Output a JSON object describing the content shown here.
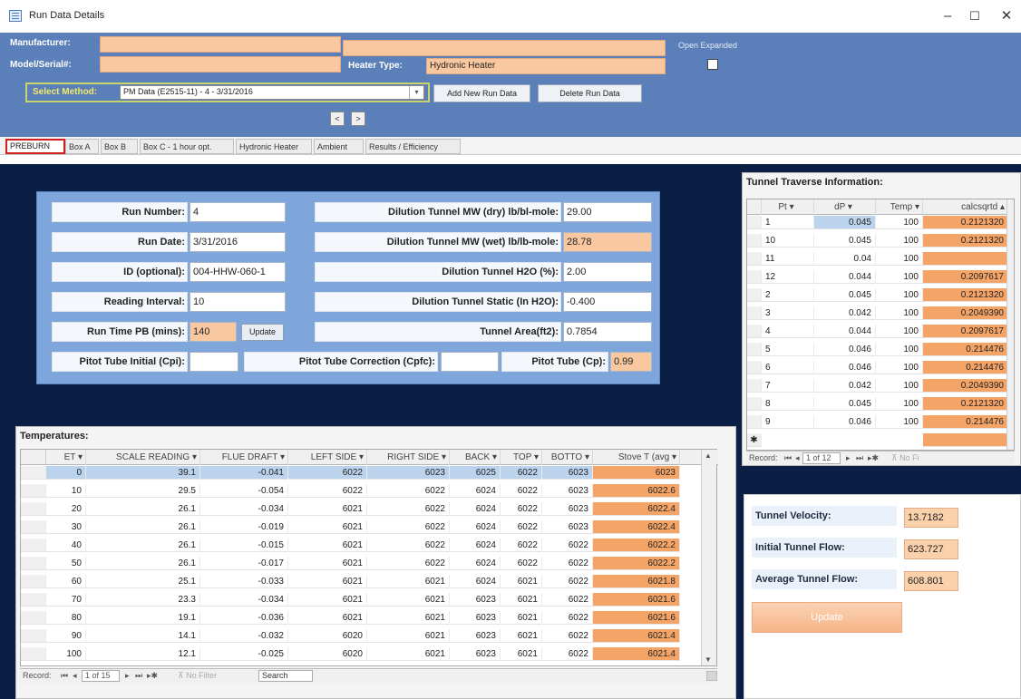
{
  "window": {
    "title": "Run Data Details",
    "minimize": "–",
    "maximize": "☐",
    "close": "✕"
  },
  "header": {
    "manufacturer_label": "Manufacturer:",
    "manufacturer_value": "",
    "manufacturer_value2": "",
    "model_label": "Model/Serial#:",
    "model_value": "",
    "heater_type_label": "Heater Type:",
    "heater_type_value": "Hydronic Heater",
    "open_expanded_label": "Open Expanded",
    "open_expanded_checked": false,
    "select_method_label": "Select Method:",
    "select_method_value": "PM Data (E2515-11) - 4 - 3/31/2016",
    "add_button": "Add New Run Data",
    "delete_button": "Delete Run Data",
    "prev": "<",
    "next": ">"
  },
  "tabs": [
    {
      "label": "PREBURN"
    },
    {
      "label": "Box A"
    },
    {
      "label": "Box B"
    },
    {
      "label": "Box C - 1 hour opt."
    },
    {
      "label": "Hydronic Heater"
    },
    {
      "label": "Ambient"
    },
    {
      "label": "Results / Efficiency"
    }
  ],
  "run": {
    "run_number_label": "Run Number:",
    "run_number": "4",
    "run_date_label": "Run Date:",
    "run_date": "3/31/2016",
    "id_label": "ID (optional):",
    "id_value": "004-HHW-060-1",
    "reading_interval_label": "Reading Interval:",
    "reading_interval": "10",
    "run_time_label": "Run Time PB (mins):",
    "run_time": "140",
    "update_label": "Update",
    "pitot_initial_label": "Pitot Tube Initial (Cpi):",
    "pitot_initial": "",
    "pitot_correction_label": "Pitot Tube Correction (Cpfc):",
    "pitot_correction": "",
    "pitot_cp_label": "Pitot Tube (Cp):",
    "pitot_cp": "0.99",
    "mw_dry_label": "Dilution Tunnel MW (dry) lb/bl-mole:",
    "mw_dry": "29.00",
    "mw_wet_label": "Dilution Tunnel MW (wet) lb/lb-mole:",
    "mw_wet": "28.78",
    "h2o_label": "Dilution Tunnel H2O (%):",
    "h2o": "2.00",
    "static_label": "Dilution Tunnel Static (In H2O):",
    "static": "-0.400",
    "area_label": "Tunnel Area(ft2):",
    "area": "0.7854"
  },
  "temperatures": {
    "title": "Temperatures:",
    "columns": [
      "ET",
      "SCALE READING",
      "FLUE DRAFT",
      "LEFT SIDE",
      "RIGHT SIDE",
      "BACK",
      "TOP",
      "BOTTO",
      "Stove T (avg"
    ],
    "rows": [
      [
        "0",
        "39.1",
        "-0.041",
        "6022",
        "6023",
        "6025",
        "6022",
        "6023",
        "6023"
      ],
      [
        "10",
        "29.5",
        "-0.054",
        "6022",
        "6022",
        "6024",
        "6022",
        "6023",
        "6022.6"
      ],
      [
        "20",
        "26.1",
        "-0.034",
        "6021",
        "6022",
        "6024",
        "6022",
        "6023",
        "6022.4"
      ],
      [
        "30",
        "26.1",
        "-0.019",
        "6021",
        "6022",
        "6024",
        "6022",
        "6023",
        "6022.4"
      ],
      [
        "40",
        "26.1",
        "-0.015",
        "6021",
        "6022",
        "6024",
        "6022",
        "6022",
        "6022.2"
      ],
      [
        "50",
        "26.1",
        "-0.017",
        "6021",
        "6022",
        "6024",
        "6022",
        "6022",
        "6022.2"
      ],
      [
        "60",
        "25.1",
        "-0.033",
        "6021",
        "6021",
        "6024",
        "6021",
        "6022",
        "6021.8"
      ],
      [
        "70",
        "23.3",
        "-0.034",
        "6021",
        "6021",
        "6023",
        "6021",
        "6022",
        "6021.6"
      ],
      [
        "80",
        "19.1",
        "-0.036",
        "6021",
        "6021",
        "6023",
        "6021",
        "6022",
        "6021.6"
      ],
      [
        "90",
        "14.1",
        "-0.032",
        "6020",
        "6021",
        "6023",
        "6021",
        "6022",
        "6021.4"
      ],
      [
        "100",
        "12.1",
        "-0.025",
        "6020",
        "6021",
        "6023",
        "6021",
        "6022",
        "6021.4"
      ]
    ],
    "nav": {
      "record_label": "Record:",
      "position": "1 of 15",
      "filter": "No Filter",
      "search": "Search"
    }
  },
  "tunnel": {
    "title": "Tunnel Traverse Information:",
    "columns": [
      "Pt",
      "dP",
      "Temp",
      "calcsqrtd"
    ],
    "rows": [
      [
        "1",
        "0.045",
        "100",
        "0.2121320"
      ],
      [
        "10",
        "0.045",
        "100",
        "0.2121320"
      ],
      [
        "11",
        "0.04",
        "100",
        ""
      ],
      [
        "12",
        "0.044",
        "100",
        "0.2097617"
      ],
      [
        "2",
        "0.045",
        "100",
        "0.2121320"
      ],
      [
        "3",
        "0.042",
        "100",
        "0.2049390"
      ],
      [
        "4",
        "0.044",
        "100",
        "0.2097617"
      ],
      [
        "5",
        "0.046",
        "100",
        "0.214476"
      ],
      [
        "6",
        "0.046",
        "100",
        "0.214476"
      ],
      [
        "7",
        "0.042",
        "100",
        "0.2049390"
      ],
      [
        "8",
        "0.045",
        "100",
        "0.2121320"
      ],
      [
        "9",
        "0.046",
        "100",
        "0.214476"
      ]
    ],
    "nav": {
      "record_label": "Record:",
      "position": "1 of 12",
      "filter": "No Fi"
    }
  },
  "velocity": {
    "velocity_label": "Tunnel Velocity:",
    "velocity": "13.7182",
    "initial_flow_label": "Initial Tunnel Flow:",
    "initial_flow": "623.727",
    "average_flow_label": "Average Tunnel Flow:",
    "average_flow": "608.801",
    "update_label": "Update"
  }
}
